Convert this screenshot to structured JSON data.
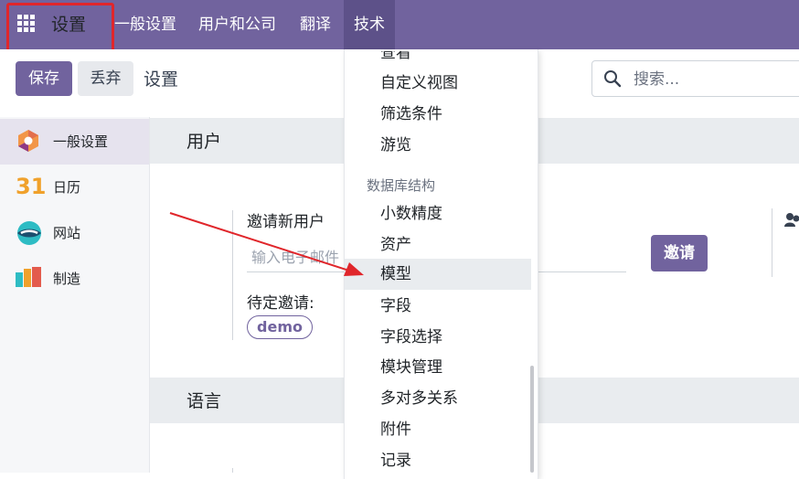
{
  "topbar": {
    "app_title": "设置",
    "menu": [
      "一般设置",
      "用户和公司",
      "翻译",
      "技术"
    ]
  },
  "controls": {
    "save_label": "保存",
    "discard_label": "丢弃",
    "breadcrumb": "设置",
    "search_placeholder": "搜索..."
  },
  "sidebar": {
    "items": [
      {
        "label": "一般设置",
        "icon": "settings-app-icon"
      },
      {
        "label": "日历",
        "icon": "calendar-app-icon",
        "icon_text": "31"
      },
      {
        "label": "网站",
        "icon": "website-app-icon"
      },
      {
        "label": "制造",
        "icon": "manufacturing-app-icon"
      }
    ]
  },
  "users_section": {
    "title": "用户",
    "invite_label": "邀请新用户",
    "email_placeholder": "输入电子邮件",
    "invite_button": "邀请",
    "pending_label": "待定邀请:",
    "pending_tag": "demo"
  },
  "language_section": {
    "title": "语言"
  },
  "dropdown": {
    "items_top": [
      "查看",
      "自定义视图",
      "筛选条件",
      "游览"
    ],
    "header": "数据库结构",
    "items": [
      "小数精度",
      "资产",
      "模型",
      "字段",
      "字段选择",
      "模块管理",
      "多对多关系",
      "附件",
      "记录"
    ]
  },
  "colors": {
    "brand": "#71639e",
    "highlight": "#e0262b"
  }
}
